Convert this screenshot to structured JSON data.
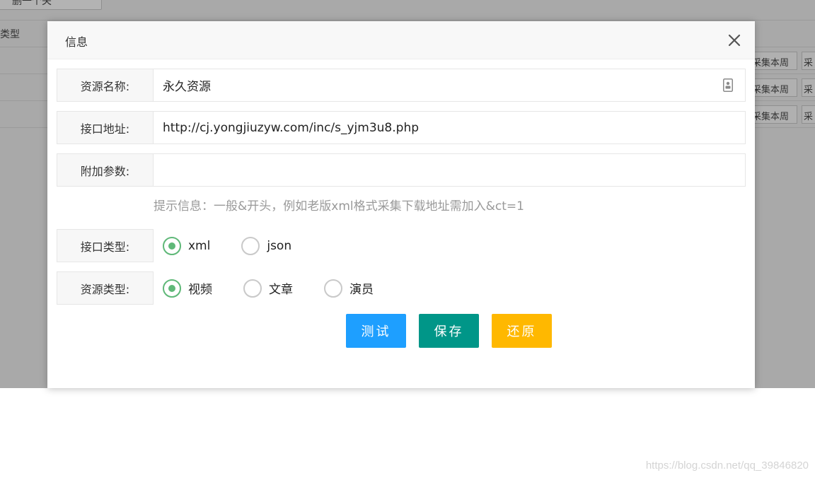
{
  "background": {
    "top_button_label": "删一个关",
    "table_header_type": "类型",
    "row_buttons": [
      {
        "collect_week": "采集本周",
        "collect_more": "采"
      },
      {
        "collect_week": "采集本周",
        "collect_more": "采"
      },
      {
        "collect_week": "采集本周",
        "collect_more": "采"
      }
    ]
  },
  "modal": {
    "title": "信息",
    "close_icon": "close-icon",
    "fields": {
      "name_label": "资源名称:",
      "name_value": "永久资源",
      "api_label": "接口地址:",
      "api_value": "http://cj.yongjiuzyw.com/inc/s_yjm3u8.php",
      "params_label": "附加参数:",
      "params_value": "",
      "hint": "提示信息：一般&开头，例如老版xml格式采集下载地址需加入&ct=1",
      "api_type_label": "接口类型:",
      "api_type_options": [
        "xml",
        "json"
      ],
      "api_type_selected": "xml",
      "res_type_label": "资源类型:",
      "res_type_options": [
        "视频",
        "文章",
        "演员"
      ],
      "res_type_selected": "视频"
    },
    "buttons": {
      "test": "测试",
      "save": "保存",
      "reset": "还原"
    },
    "colors": {
      "test": "#1e9fff",
      "save": "#009688",
      "reset": "#ffb800",
      "radio_checked": "#5fb878"
    }
  },
  "watermark": "https://blog.csdn.net/qq_39846820"
}
